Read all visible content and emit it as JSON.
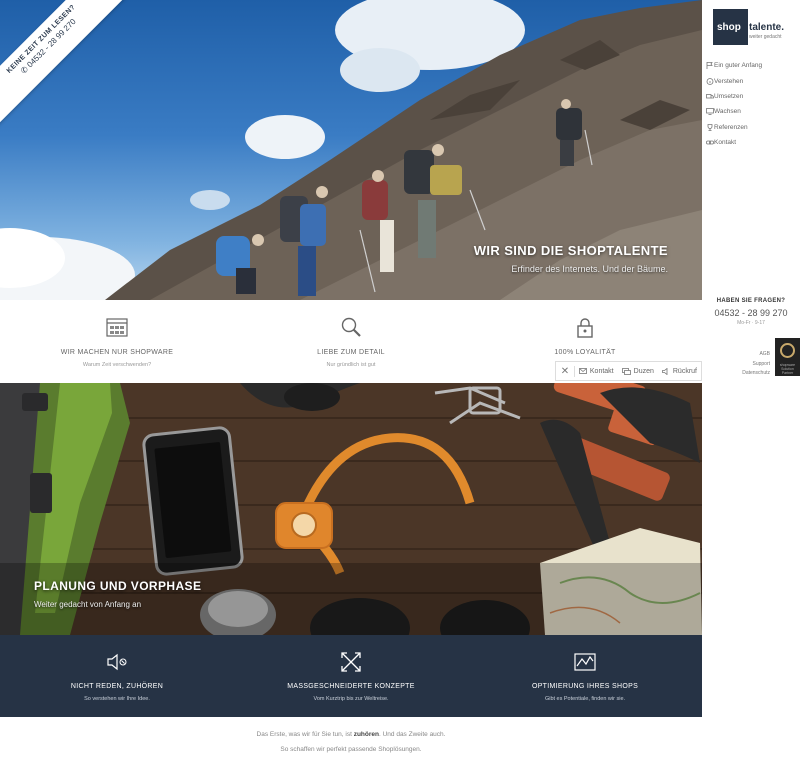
{
  "ribbon": {
    "line1": "KEINE ZEIT ZUM LESEN?",
    "line2": "04532 - 28 99 270"
  },
  "hero": {
    "title": "WIR SIND DIE SHOPTALENTE",
    "subtitle": "Erfinder des Internets. Und der Bäume."
  },
  "features": [
    {
      "icon": "browser-grid-icon",
      "title": "WIR MACHEN NUR SHOPWARE",
      "subtitle": "Warum Zeit verschwenden?"
    },
    {
      "icon": "magnifier-icon",
      "title": "LIEBE ZUM DETAIL",
      "subtitle": "Nur gründlich ist gut"
    },
    {
      "icon": "lock-icon",
      "title": "100% LOYALITÄT",
      "subtitle": "Keine Kompromisse"
    }
  ],
  "contact_bar": {
    "close": "✕",
    "kontakt": "Kontakt",
    "duzen": "Duzen",
    "rueckruf": "Rückruf"
  },
  "tools": {
    "title": "PLANUNG UND VORPHASE",
    "subtitle": "Weiter gedacht von Anfang an"
  },
  "band": [
    {
      "icon": "speaker-mute-icon",
      "title": "NICHT REDEN, ZUHÖREN",
      "subtitle": "So verstehen wir Ihre Idee."
    },
    {
      "icon": "expand-arrows-icon",
      "title": "MASSGESCHNEIDERTE KONZEPTE",
      "subtitle": "Vom Kurztrip bis zur Weltreise."
    },
    {
      "icon": "chart-icon",
      "title": "OPTIMIERUNG IHRES SHOPS",
      "subtitle": "Gibt es Potentiale, finden wir sie."
    }
  ],
  "footer": {
    "line1_prefix": "Das Erste, was wir für Sie tun, ist ",
    "line1_bold": "zuhören",
    "line1_suffix": ". Und das Zweite auch.",
    "line2": "So schaffen wir perfekt passende Shoplösungen."
  },
  "sidebar": {
    "logo_shop": "shop",
    "logo_talente": "talente.",
    "logo_tagline": "weiter gedacht",
    "nav": [
      {
        "icon": "flag-icon",
        "label": "Ein guter Anfang"
      },
      {
        "icon": "info-icon",
        "label": "Verstehen"
      },
      {
        "icon": "truck-icon",
        "label": "Umsetzen"
      },
      {
        "icon": "monitor-icon",
        "label": "Wachsen"
      },
      {
        "icon": "trophy-icon",
        "label": "Referenzen"
      },
      {
        "icon": "link-icon",
        "label": "Kontakt"
      }
    ],
    "questions_title": "HABEN SIE FRAGEN?",
    "phone": "04532 - 28 99 270",
    "hours": "Mo-Fr · 9-17",
    "links": [
      "AGB",
      "Support",
      "Datenschutz"
    ],
    "badge_label": "shopware",
    "badge_sub": "Solution Partner"
  },
  "colors": {
    "navy": "#263345",
    "accent_orange": "#e08a2c",
    "sky": "#3a7cc4"
  }
}
